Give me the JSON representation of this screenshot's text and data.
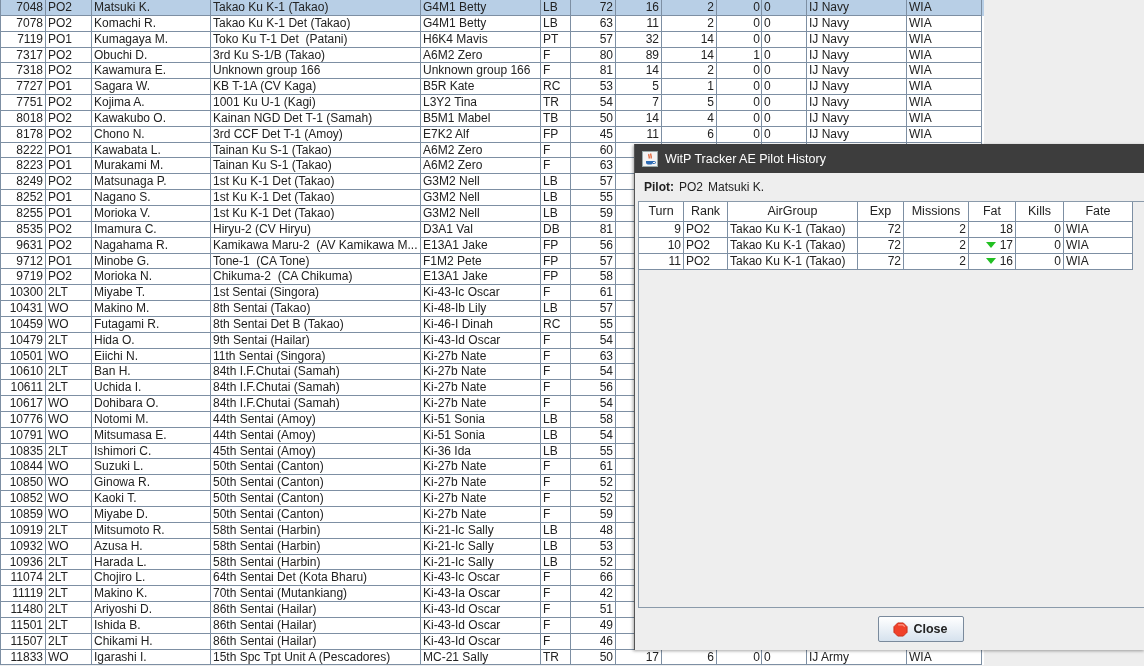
{
  "pilot_table": {
    "rows": [
      {
        "selected": true,
        "cells": [
          "7048",
          "PO2",
          "Matsuki K.",
          "Takao Ku K-1 (Takao)",
          "G4M1 Betty",
          "LB",
          "72",
          "16",
          "2",
          "0",
          "0",
          "IJ Navy",
          "WIA"
        ]
      },
      {
        "selected": false,
        "cells": [
          "7078",
          "PO2",
          "Komachi R.",
          "Takao Ku K-1 Det (Takao)",
          "G4M1 Betty",
          "LB",
          "63",
          "11",
          "2",
          "0",
          "0",
          "IJ Navy",
          "WIA"
        ]
      },
      {
        "selected": false,
        "cells": [
          "7119",
          "PO1",
          "Kumagaya M.",
          "Toko Ku T-1 Det  (Patani)",
          "H6K4 Mavis",
          "PT",
          "57",
          "32",
          "14",
          "0",
          "0",
          "IJ Navy",
          "WIA"
        ]
      },
      {
        "selected": false,
        "cells": [
          "7317",
          "PO2",
          "Obuchi D.",
          "3rd Ku S-1/B (Takao)",
          "A6M2 Zero",
          "F",
          "80",
          "89",
          "14",
          "1",
          "0",
          "IJ Navy",
          "WIA"
        ]
      },
      {
        "selected": false,
        "cells": [
          "7318",
          "PO2",
          "Kawamura E.",
          "Unknown group 166",
          "Unknown group 166",
          "F",
          "81",
          "14",
          "2",
          "0",
          "0",
          "IJ Navy",
          "WIA"
        ]
      },
      {
        "selected": false,
        "cells": [
          "7727",
          "PO1",
          "Sagara W.",
          "KB T-1A (CV Kaga)",
          "B5R Kate",
          "RC",
          "53",
          "5",
          "1",
          "0",
          "0",
          "IJ Navy",
          "WIA"
        ]
      },
      {
        "selected": false,
        "cells": [
          "7751",
          "PO2",
          "Kojima A.",
          "1001 Ku U-1 (Kagi)",
          "L3Y2 Tina",
          "TR",
          "54",
          "7",
          "5",
          "0",
          "0",
          "IJ Navy",
          "WIA"
        ]
      },
      {
        "selected": false,
        "cells": [
          "8018",
          "PO2",
          "Kawakubo O.",
          "Kainan NGD Det T-1 (Samah)",
          "B5M1 Mabel",
          "TB",
          "50",
          "14",
          "4",
          "0",
          "0",
          "IJ Navy",
          "WIA"
        ]
      },
      {
        "selected": false,
        "cells": [
          "8178",
          "PO2",
          "Chono N.",
          "3rd CCF Det T-1 (Amoy)",
          "E7K2 Alf",
          "FP",
          "45",
          "11",
          "6",
          "0",
          "0",
          "IJ Navy",
          "WIA"
        ]
      },
      {
        "selected": false,
        "cells": [
          "8222",
          "PO1",
          "Kawabata L.",
          "Tainan Ku S-1 (Takao)",
          "A6M2 Zero",
          "F",
          "60"
        ]
      },
      {
        "selected": false,
        "cells": [
          "8223",
          "PO1",
          "Murakami M.",
          "Tainan Ku S-1 (Takao)",
          "A6M2 Zero",
          "F",
          "63"
        ]
      },
      {
        "selected": false,
        "cells": [
          "8249",
          "PO2",
          "Matsunaga P.",
          "1st Ku K-1 Det (Takao)",
          "G3M2 Nell",
          "LB",
          "57"
        ]
      },
      {
        "selected": false,
        "cells": [
          "8252",
          "PO1",
          "Nagano S.",
          "1st Ku K-1 Det (Takao)",
          "G3M2 Nell",
          "LB",
          "55"
        ]
      },
      {
        "selected": false,
        "cells": [
          "8255",
          "PO1",
          "Morioka V.",
          "1st Ku K-1 Det (Takao)",
          "G3M2 Nell",
          "LB",
          "59"
        ]
      },
      {
        "selected": false,
        "cells": [
          "8535",
          "PO2",
          "Imamura C.",
          "Hiryu-2 (CV Hiryu)",
          "D3A1 Val",
          "DB",
          "81"
        ]
      },
      {
        "selected": false,
        "cells": [
          "9631",
          "PO2",
          "Nagahama R.",
          "Kamikawa Maru-2  (AV Kamikawa M...",
          "E13A1 Jake",
          "FP",
          "56"
        ]
      },
      {
        "selected": false,
        "cells": [
          "9712",
          "PO1",
          "Minobe G.",
          "Tone-1  (CA Tone)",
          "F1M2 Pete",
          "FP",
          "57"
        ]
      },
      {
        "selected": false,
        "cells": [
          "9719",
          "PO2",
          "Morioka N.",
          "Chikuma-2  (CA Chikuma)",
          "E13A1 Jake",
          "FP",
          "58"
        ]
      },
      {
        "selected": false,
        "cells": [
          "10300",
          "2LT",
          "Miyabe T.",
          "1st Sentai (Singora)",
          "Ki-43-Ic Oscar",
          "F",
          "61"
        ]
      },
      {
        "selected": false,
        "cells": [
          "10431",
          "WO",
          "Makino M.",
          "8th Sentai (Takao)",
          "Ki-48-Ib Lily",
          "LB",
          "57"
        ]
      },
      {
        "selected": false,
        "cells": [
          "10459",
          "WO",
          "Futagami R.",
          "8th Sentai Det B (Takao)",
          "Ki-46-I Dinah",
          "RC",
          "55"
        ]
      },
      {
        "selected": false,
        "cells": [
          "10479",
          "2LT",
          "Hida O.",
          "9th Sentai (Hailar)",
          "Ki-43-Id Oscar",
          "F",
          "54"
        ]
      },
      {
        "selected": false,
        "cells": [
          "10501",
          "WO",
          "Eiichi N.",
          "11th Sentai (Singora)",
          "Ki-27b Nate",
          "F",
          "63"
        ]
      },
      {
        "selected": false,
        "cells": [
          "10610",
          "2LT",
          "Ban H.",
          "84th I.F.Chutai (Samah)",
          "Ki-27b Nate",
          "F",
          "54"
        ]
      },
      {
        "selected": false,
        "cells": [
          "10611",
          "2LT",
          "Uchida I.",
          "84th I.F.Chutai (Samah)",
          "Ki-27b Nate",
          "F",
          "56"
        ]
      },
      {
        "selected": false,
        "cells": [
          "10617",
          "WO",
          "Dohibara O.",
          "84th I.F.Chutai (Samah)",
          "Ki-27b Nate",
          "F",
          "54"
        ]
      },
      {
        "selected": false,
        "cells": [
          "10776",
          "WO",
          "Notomi M.",
          "44th Sentai (Amoy)",
          "Ki-51 Sonia",
          "LB",
          "58"
        ]
      },
      {
        "selected": false,
        "cells": [
          "10791",
          "WO",
          "Mitsumasa E.",
          "44th Sentai (Amoy)",
          "Ki-51 Sonia",
          "LB",
          "54"
        ]
      },
      {
        "selected": false,
        "cells": [
          "10835",
          "2LT",
          "Ishimori C.",
          "45th Sentai (Amoy)",
          "Ki-36 Ida",
          "LB",
          "55"
        ]
      },
      {
        "selected": false,
        "cells": [
          "10844",
          "WO",
          "Suzuki L.",
          "50th Sentai (Canton)",
          "Ki-27b Nate",
          "F",
          "61"
        ]
      },
      {
        "selected": false,
        "cells": [
          "10850",
          "WO",
          "Ginowa R.",
          "50th Sentai (Canton)",
          "Ki-27b Nate",
          "F",
          "52"
        ]
      },
      {
        "selected": false,
        "cells": [
          "10852",
          "WO",
          "Kaoki T.",
          "50th Sentai (Canton)",
          "Ki-27b Nate",
          "F",
          "52"
        ]
      },
      {
        "selected": false,
        "cells": [
          "10859",
          "WO",
          "Miyabe D.",
          "50th Sentai (Canton)",
          "Ki-27b Nate",
          "F",
          "59"
        ]
      },
      {
        "selected": false,
        "cells": [
          "10919",
          "2LT",
          "Mitsumoto R.",
          "58th Sentai (Harbin)",
          "Ki-21-Ic Sally",
          "LB",
          "48"
        ]
      },
      {
        "selected": false,
        "cells": [
          "10932",
          "WO",
          "Azusa H.",
          "58th Sentai (Harbin)",
          "Ki-21-Ic Sally",
          "LB",
          "53"
        ]
      },
      {
        "selected": false,
        "cells": [
          "10936",
          "2LT",
          "Harada L.",
          "58th Sentai (Harbin)",
          "Ki-21-Ic Sally",
          "LB",
          "52"
        ]
      },
      {
        "selected": false,
        "cells": [
          "11074",
          "2LT",
          "Chojiro L.",
          "64th Sentai Det (Kota Bharu)",
          "Ki-43-Ic Oscar",
          "F",
          "66"
        ]
      },
      {
        "selected": false,
        "cells": [
          "11119",
          "2LT",
          "Makino K.",
          "70th Sentai (Mutankiang)",
          "Ki-43-Ia Oscar",
          "F",
          "42"
        ]
      },
      {
        "selected": false,
        "cells": [
          "11480",
          "2LT",
          "Ariyoshi D.",
          "86th Sentai (Hailar)",
          "Ki-43-Id Oscar",
          "F",
          "51"
        ]
      },
      {
        "selected": false,
        "cells": [
          "11501",
          "2LT",
          "Ishida B.",
          "86th Sentai (Hailar)",
          "Ki-43-Id Oscar",
          "F",
          "49"
        ]
      },
      {
        "selected": false,
        "cells": [
          "11507",
          "2LT",
          "Chikami H.",
          "86th Sentai (Hailar)",
          "Ki-43-Id Oscar",
          "F",
          "46"
        ]
      },
      {
        "selected": false,
        "cells": [
          "11833",
          "WO",
          "Igarashi I.",
          "15th Spc Tpt Unit A (Pescadores)",
          "MC-21 Sally",
          "TR",
          "50",
          "17",
          "6",
          "0",
          "0",
          "IJ Army",
          "WIA"
        ]
      }
    ]
  },
  "dialog": {
    "title": "WitP Tracker AE Pilot History",
    "pilot_label": "Pilot:",
    "pilot_rank": "PO2",
    "pilot_name": "Matsuki K.",
    "history": {
      "columns": [
        "Turn",
        "Rank",
        "AirGroup",
        "Exp",
        "Missions",
        "Fat",
        "Kills",
        "Fate"
      ],
      "rows": [
        {
          "fat_decreased": false,
          "cells": [
            "9",
            "PO2",
            "Takao Ku K-1 (Takao)",
            "72",
            "2",
            "18",
            "0",
            "WIA"
          ]
        },
        {
          "fat_decreased": true,
          "cells": [
            "10",
            "PO2",
            "Takao Ku K-1 (Takao)",
            "72",
            "2",
            "17",
            "0",
            "WIA"
          ]
        },
        {
          "fat_decreased": true,
          "cells": [
            "11",
            "PO2",
            "Takao Ku K-1 (Takao)",
            "72",
            "2",
            "16",
            "0",
            "WIA"
          ]
        }
      ]
    },
    "close_button": "Close"
  }
}
